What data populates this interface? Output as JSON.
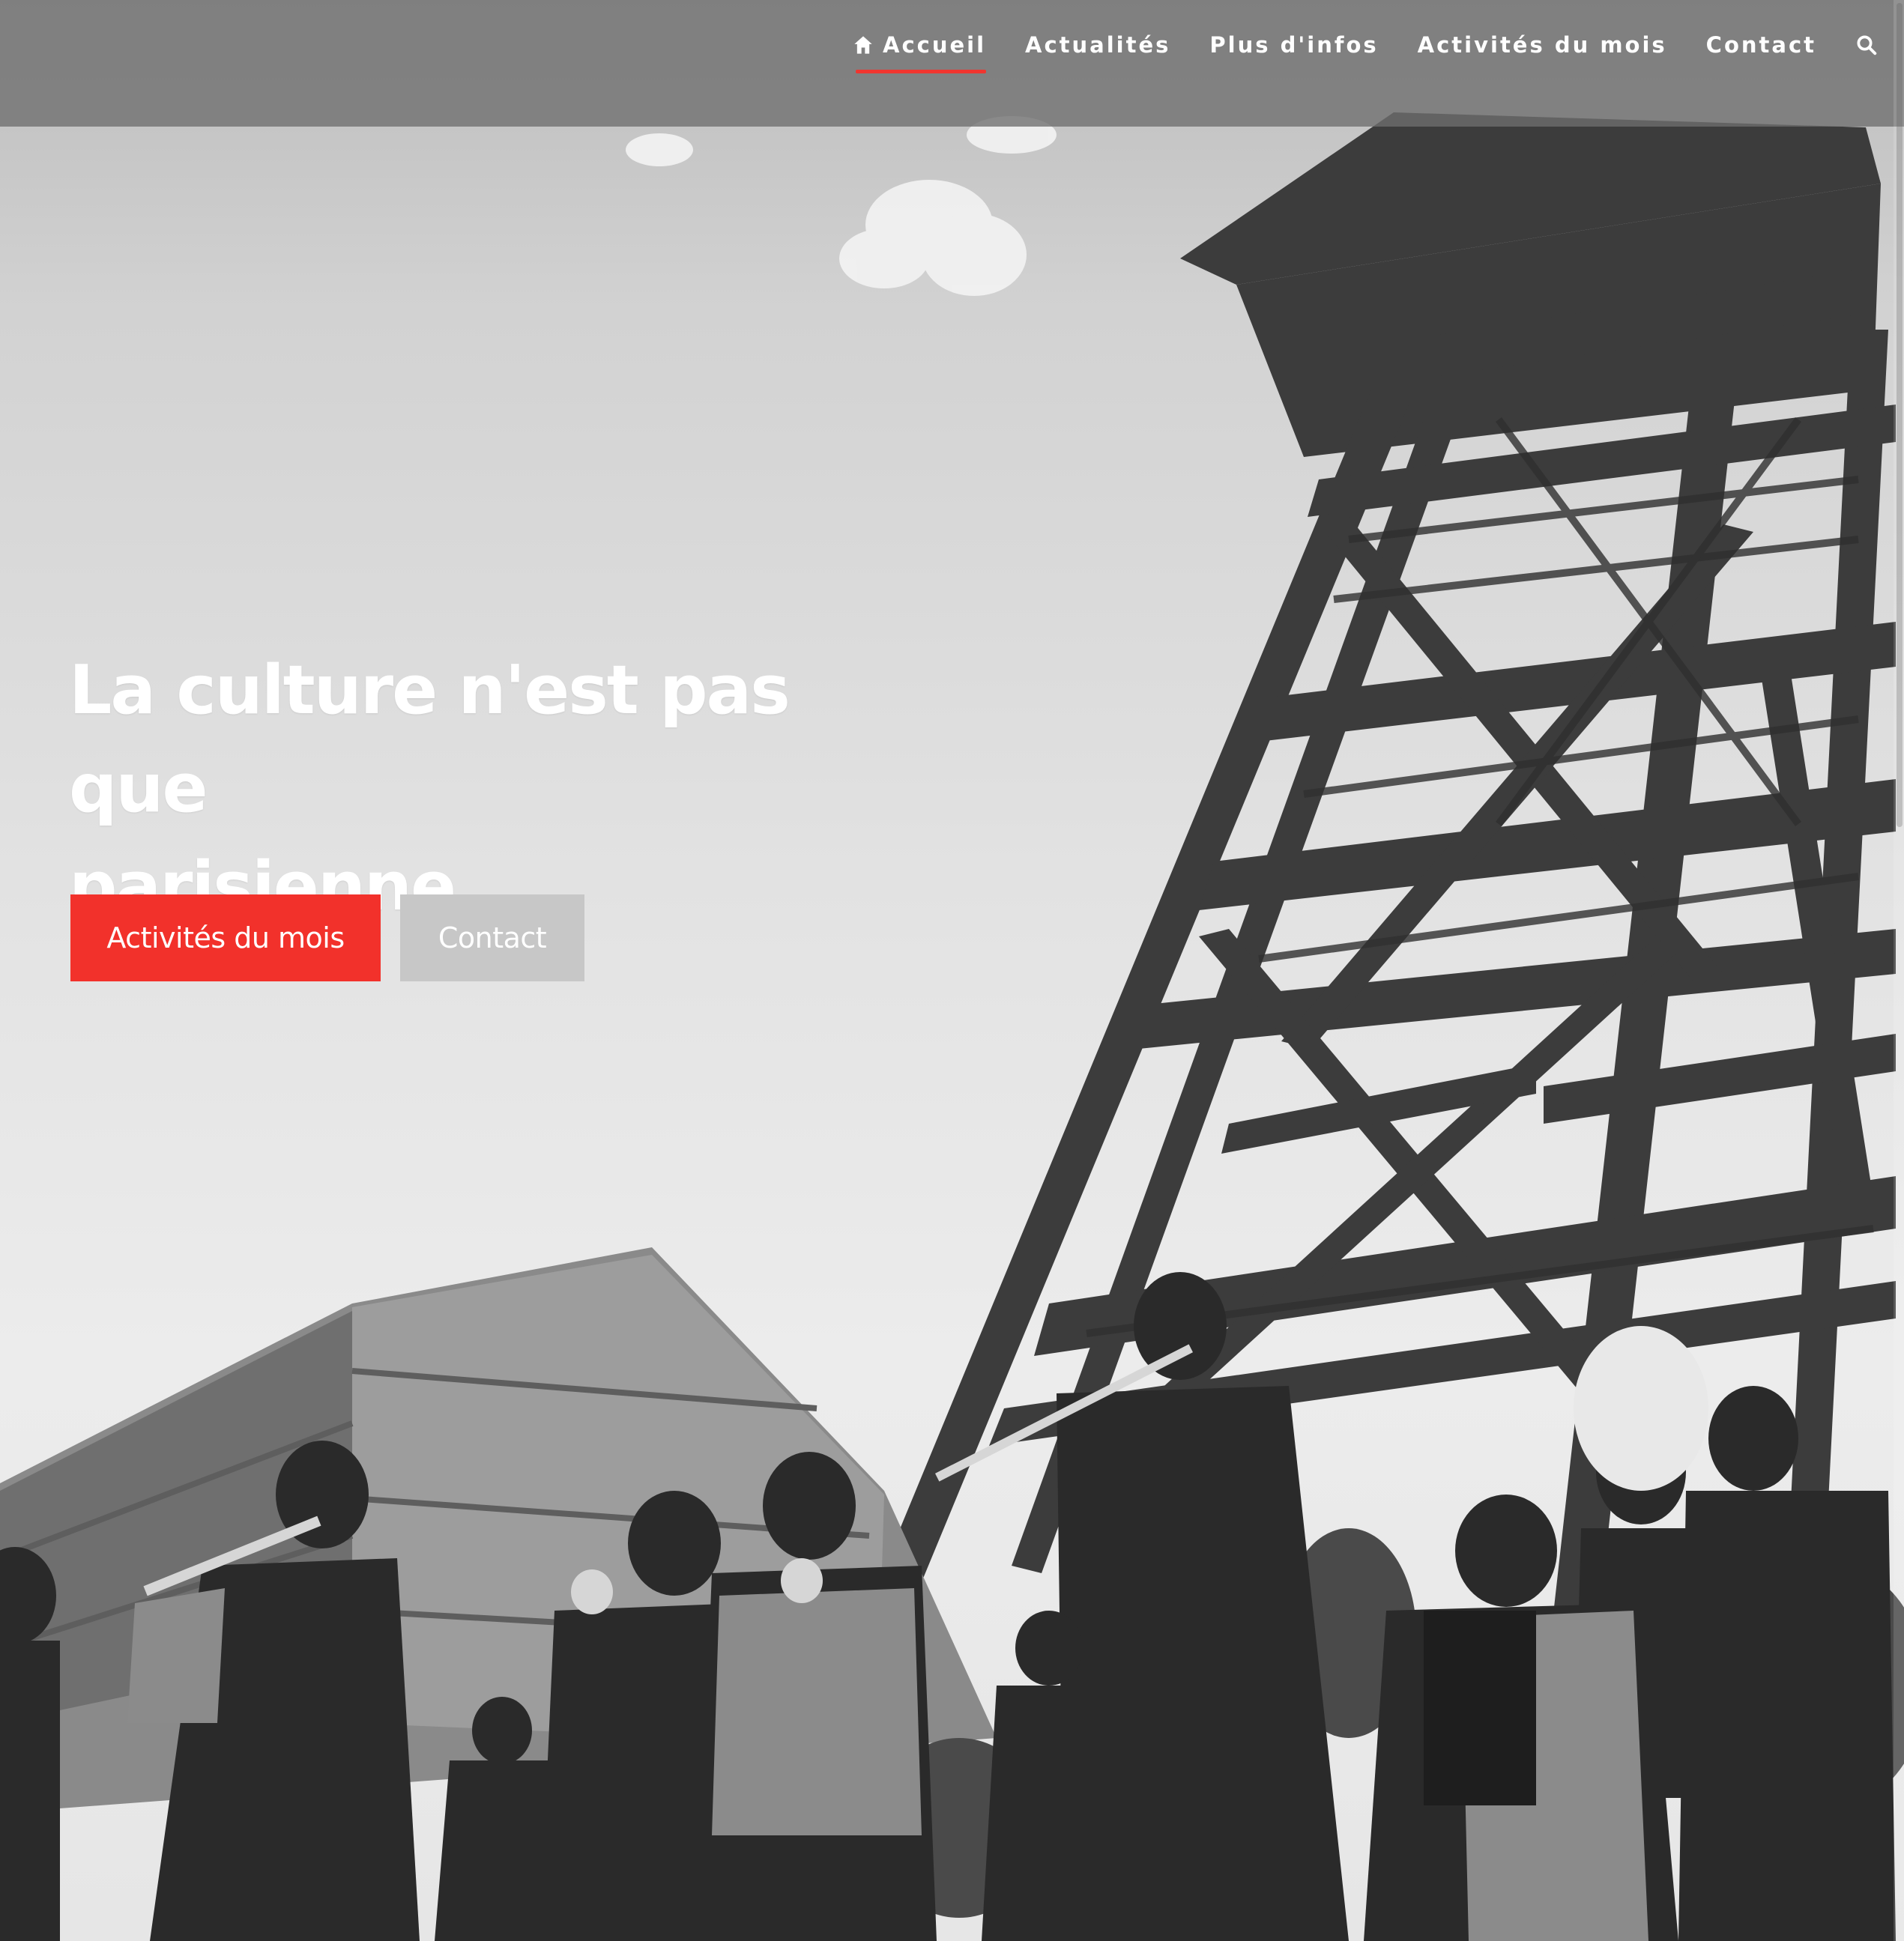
{
  "nav": {
    "items": [
      {
        "label": "Accueil",
        "icon": "home-icon",
        "active": true
      },
      {
        "label": "Actualités",
        "active": false
      },
      {
        "label": "Plus d'infos",
        "active": false
      },
      {
        "label": "Activités du mois",
        "active": false
      },
      {
        "label": "Contact",
        "active": false
      }
    ],
    "search_icon": "search-icon"
  },
  "hero": {
    "headline_line1": "La culture n'est pas que",
    "headline_line2": "parisienne",
    "primary_button": "Activités du mois",
    "secondary_button": "Contact",
    "image_description_icon": "hero-photo"
  },
  "colors": {
    "accent": "#f2312b",
    "topbar": "#6e6e6e",
    "secondary_button": "#c7c7c7",
    "text": "#ffffff"
  }
}
